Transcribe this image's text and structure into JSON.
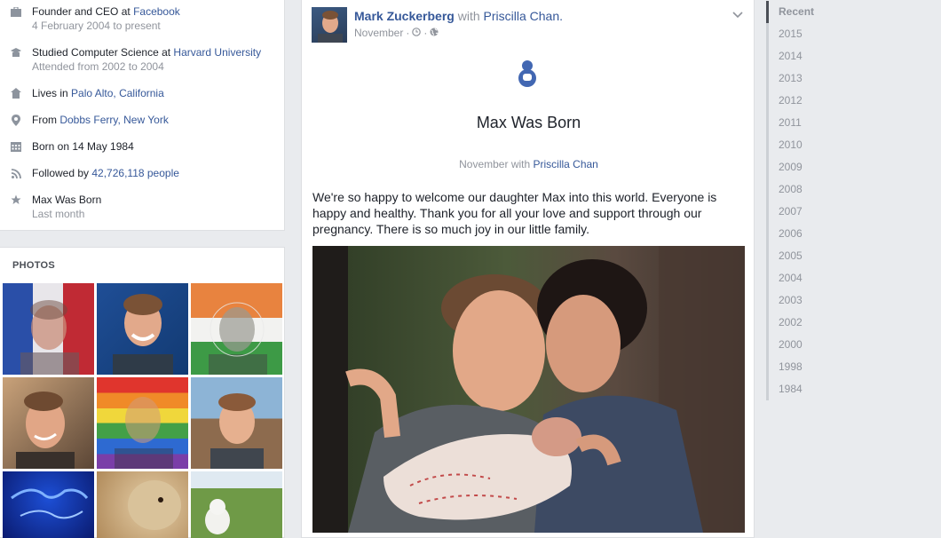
{
  "intro": {
    "work": {
      "prefix": "Founder and CEO at ",
      "company": "Facebook",
      "dates": "4 February 2004 to present"
    },
    "education": {
      "prefix": "Studied Computer Science at ",
      "school": "Harvard University",
      "dates": "Attended from 2002 to 2004"
    },
    "lives": {
      "prefix": "Lives in ",
      "place": "Palo Alto, California"
    },
    "from": {
      "prefix": "From ",
      "place": "Dobbs Ferry, New York"
    },
    "born": {
      "text": "Born on 14 May 1984"
    },
    "followed": {
      "prefix": "Followed by ",
      "count": "42,726,118 people"
    },
    "event": {
      "title": "Max Was Born",
      "time": "Last month"
    }
  },
  "photos": {
    "title": "PHOTOS"
  },
  "post": {
    "author": "Mark Zuckerberg",
    "with_word": "with",
    "tagged": "Priscilla Chan.",
    "time": "November",
    "event_title": "Max Was Born",
    "event_sub_time": "November with",
    "event_sub_person": "Priscilla Chan",
    "text": "We're so happy to welcome our daughter Max into this world. Everyone is happy and healthy. Thank you for all your love and support through our pregnancy. There is so much joy in our little family."
  },
  "timeline": {
    "years": [
      "Recent",
      "2015",
      "2014",
      "2013",
      "2012",
      "2011",
      "2010",
      "2009",
      "2008",
      "2007",
      "2006",
      "2005",
      "2004",
      "2003",
      "2002",
      "2000",
      "1998",
      "1984"
    ],
    "active": "Recent"
  },
  "icons": {
    "work": "briefcase-icon",
    "education": "graduation-cap-icon",
    "lives": "home-icon",
    "from": "location-pin-icon",
    "born": "calendar-icon",
    "followed": "rss-icon",
    "event": "star-icon",
    "life_event": "baby-icon",
    "time": "clock-icon",
    "privacy": "globe-icon",
    "menu": "chevron-down-icon"
  },
  "colors": {
    "link": "#365899",
    "muted": "#90949c",
    "background": "#e9ebee",
    "icon": "#4267b2"
  }
}
